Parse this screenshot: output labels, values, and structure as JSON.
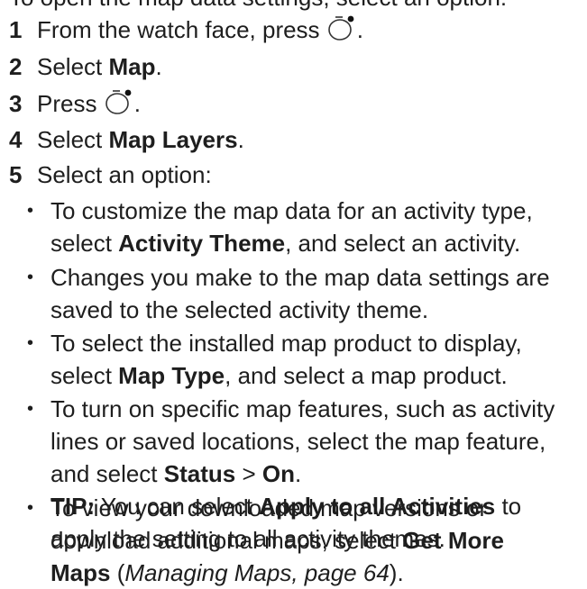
{
  "cutoff_text": "To open the map data settings, select an option:",
  "steps": [
    {
      "num": "1",
      "pre": "From the watch face, press",
      "post": "."
    },
    {
      "num": "2",
      "pre": "Select ",
      "bold": "Map",
      "post": "."
    },
    {
      "num": "3",
      "pre": "Press",
      "post": "."
    },
    {
      "num": "4",
      "pre": "Select ",
      "bold": "Map Layers",
      "post": "."
    },
    {
      "num": "5",
      "text": "Select an option:"
    }
  ],
  "bullets": {
    "b1": {
      "l1": "To customize the map data for an activity type,",
      "l2_pre": "select ",
      "l2_bold": "Activity Theme",
      "l2_post": ", and select an activity."
    },
    "b2": {
      "l1": "Changes you make to the map data settings are",
      "l2": "saved to the selected activity theme."
    },
    "b3": {
      "l1": "To select the installed map product to display,",
      "l2_pre": "select ",
      "l2_bold": "Map Type",
      "l2_post": ", and select a map product."
    },
    "b4": {
      "l1": "To turn on specific map features, such as activity",
      "l2": "lines or saved locations, select the map feature,",
      "l3_pre": "and select ",
      "l3_bold1": "Status",
      "l3_mid": " > ",
      "l3_bold2": "On",
      "l3_post": ".",
      "tip_label": "TIP:",
      "tip_pre": " You can select ",
      "tip_bold": "Apply to all Activities",
      "tip_post": " to",
      "l5": "apply the setting to all activity themes."
    },
    "b5": {
      "l1_pre": "To view your downloaded map versions or",
      "l2_pre": "download additional maps, select ",
      "l2_bold": "Get More",
      "l3_bold": "Maps",
      "l3_pre": " (",
      "l3_link": "Managing Maps, page 64",
      "l3_post": ")."
    }
  },
  "icons": {
    "watch_button": "watch-button-icon"
  }
}
